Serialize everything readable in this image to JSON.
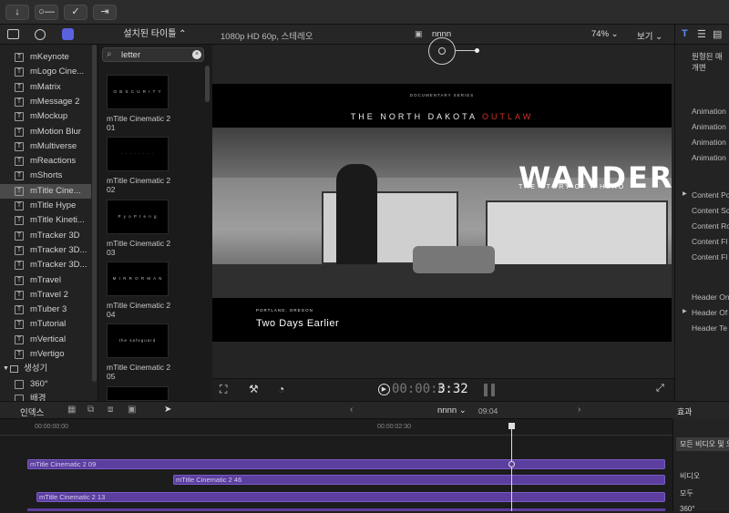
{
  "toolbar": {
    "import_icon": "↓",
    "key_icon": "○—",
    "check_icon": "✓",
    "share_icon": "⇥"
  },
  "sidebar": {
    "items": [
      {
        "label": "mKeynote"
      },
      {
        "label": "mLogo Cine..."
      },
      {
        "label": "mMatrix"
      },
      {
        "label": "mMessage 2"
      },
      {
        "label": "mMockup"
      },
      {
        "label": "mMotion Blur"
      },
      {
        "label": "mMultiverse"
      },
      {
        "label": "mReactions"
      },
      {
        "label": "mShorts"
      },
      {
        "label": "mTitle Cine..."
      },
      {
        "label": "mTitle Hype"
      },
      {
        "label": "mTitle Kineti..."
      },
      {
        "label": "mTracker 3D"
      },
      {
        "label": "mTracker 3D..."
      },
      {
        "label": "mTracker 3D..."
      },
      {
        "label": "mTravel"
      },
      {
        "label": "mTravel 2"
      },
      {
        "label": "mTuber 3"
      },
      {
        "label": "mTutorial"
      },
      {
        "label": "mVertical"
      },
      {
        "label": "mVertigo"
      }
    ],
    "generators_label": "생성기",
    "gen_item": "360°",
    "gen_item2": "배경"
  },
  "browser": {
    "title": "설치된 타이틀 ⌃",
    "search_value": "letter",
    "items": [
      {
        "label": "mTitle Cinematic 2 01",
        "thumb": "O B S C U R I T Y"
      },
      {
        "label": "mTitle Cinematic 2 02",
        "thumb": "· · · · · · · ·"
      },
      {
        "label": "mTitle Cinematic 2 03",
        "thumb": "P y o P t e n g"
      },
      {
        "label": "mTitle Cinematic 2 04",
        "thumb": "M I R R O R  M A N"
      },
      {
        "label": "mTitle Cinematic 2 05",
        "thumb": "the safeguard"
      }
    ]
  },
  "viewer": {
    "format": "1080p HD 60p, 스테레오",
    "project": "nnnn",
    "zoom": "74% ⌄",
    "view": "보기 ⌄",
    "small_series": "DOCUMENTARY SERIES",
    "headline_a": "THE NORTH DAKOTA",
    "headline_b": "OUTLAW",
    "big_title": "WANDERER",
    "big_sub": "THE STORY OF A HERO",
    "place": "PORTLAND, OREGON",
    "caption": "Two Days Earlier",
    "timecode_dim": "00:00:0",
    "timecode": "3:32"
  },
  "inspector": {
    "header": "원형된 매개변",
    "rows": [
      "Animation",
      "Animation",
      "Animation",
      "Animation",
      "Content Po",
      "Content Sc",
      "Content Ro",
      "Content Fl",
      "Content Fl",
      "Header On",
      "Header Of",
      "Header Te"
    ]
  },
  "timeline": {
    "index_label": "인덱스",
    "project": "nnnn ⌄",
    "duration": "09:04",
    "tc_start": "00:00:00:00",
    "tc_mid": "00:00:02:30",
    "clips": [
      {
        "label": "mTitle Cinematic 2 09"
      },
      {
        "label": "mTitle Cinematic 2 46"
      },
      {
        "label": "mTitle Cinematic 2 13"
      }
    ]
  },
  "effects": {
    "title": "효과",
    "all": "모든 비디오 및 오",
    "video": "비디오",
    "all2": "모두",
    "deg": "360°"
  },
  "colors": {
    "accent": "#5b3e9e",
    "outlaw": "#d0312d",
    "panel": "#232323"
  }
}
